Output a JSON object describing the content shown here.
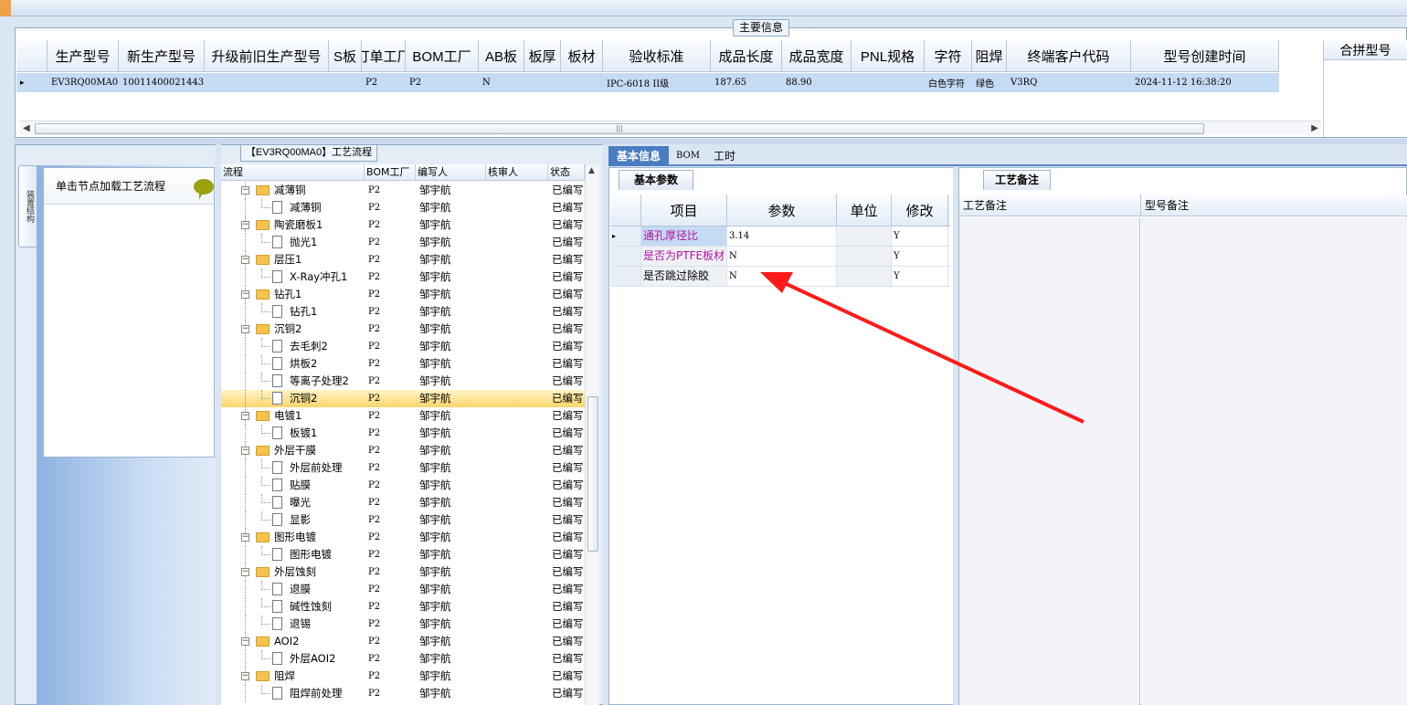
{
  "main_info": {
    "group_title": "主要信息",
    "columns": [
      "生产型号",
      "新生产型号",
      "升级前旧生产型号",
      "S板",
      "订单工厂",
      "BOM工厂",
      "AB板",
      "板厚",
      "板材",
      "验收标准",
      "成品长度",
      "成品宽度",
      "PNL规格",
      "字符",
      "阻焊",
      "终端客户代码",
      "型号创建时间"
    ],
    "row": [
      "EV3RQ00MA0",
      "10011400021443",
      "",
      "",
      "P2",
      "P2",
      "N",
      "",
      "",
      "IPC-6018 II级",
      "187.65",
      "88.90",
      "",
      "白色字符",
      "绿色",
      "V3RQ",
      "2024-11-12 16:38:20"
    ],
    "merge_header": "合拼型号"
  },
  "left": {
    "side_tab": "装置结构",
    "node_load_button": "单击节点加载工艺流程",
    "flow_title": "【EV3RQ00MA0】工艺流程",
    "tree_columns": [
      "流程",
      "BOM工厂",
      "编写人",
      "核审人",
      "状态"
    ],
    "tree_rows": [
      {
        "level": 0,
        "label": "减薄铜",
        "bom": "P2",
        "writer": "邹宇航",
        "reviewer": "",
        "status": "已编写"
      },
      {
        "level": 1,
        "label": "减薄铜",
        "bom": "P2",
        "writer": "邹宇航",
        "reviewer": "",
        "status": "已编写"
      },
      {
        "level": 0,
        "label": "陶瓷磨板1",
        "bom": "P2",
        "writer": "邹宇航",
        "reviewer": "",
        "status": "已编写"
      },
      {
        "level": 1,
        "label": "抛光1",
        "bom": "P2",
        "writer": "邹宇航",
        "reviewer": "",
        "status": "已编写"
      },
      {
        "level": 0,
        "label": "层压1",
        "bom": "P2",
        "writer": "邹宇航",
        "reviewer": "",
        "status": "已编写"
      },
      {
        "level": 1,
        "label": "X-Ray冲孔1",
        "bom": "P2",
        "writer": "邹宇航",
        "reviewer": "",
        "status": "已编写"
      },
      {
        "level": 0,
        "label": "钻孔1",
        "bom": "P2",
        "writer": "邹宇航",
        "reviewer": "",
        "status": "已编写"
      },
      {
        "level": 1,
        "label": "钻孔1",
        "bom": "P2",
        "writer": "邹宇航",
        "reviewer": "",
        "status": "已编写"
      },
      {
        "level": 0,
        "label": "沉铜2",
        "bom": "P2",
        "writer": "邹宇航",
        "reviewer": "",
        "status": "已编写"
      },
      {
        "level": 1,
        "label": "去毛刺2",
        "bom": "P2",
        "writer": "邹宇航",
        "reviewer": "",
        "status": "已编写"
      },
      {
        "level": 1,
        "label": "烘板2",
        "bom": "P2",
        "writer": "邹宇航",
        "reviewer": "",
        "status": "已编写"
      },
      {
        "level": 1,
        "label": "等离子处理2",
        "bom": "P2",
        "writer": "邹宇航",
        "reviewer": "",
        "status": "已编写"
      },
      {
        "level": 1,
        "label": "沉铜2",
        "bom": "P2",
        "writer": "邹宇航",
        "reviewer": "",
        "status": "已编写",
        "selected": true
      },
      {
        "level": 0,
        "label": "电镀1",
        "bom": "P2",
        "writer": "邹宇航",
        "reviewer": "",
        "status": "已编写"
      },
      {
        "level": 1,
        "label": "板镀1",
        "bom": "P2",
        "writer": "邹宇航",
        "reviewer": "",
        "status": "已编写"
      },
      {
        "level": 0,
        "label": "外层干膜",
        "bom": "P2",
        "writer": "邹宇航",
        "reviewer": "",
        "status": "已编写"
      },
      {
        "level": 1,
        "label": "外层前处理",
        "bom": "P2",
        "writer": "邹宇航",
        "reviewer": "",
        "status": "已编写"
      },
      {
        "level": 1,
        "label": "贴膜",
        "bom": "P2",
        "writer": "邹宇航",
        "reviewer": "",
        "status": "已编写"
      },
      {
        "level": 1,
        "label": "曝光",
        "bom": "P2",
        "writer": "邹宇航",
        "reviewer": "",
        "status": "已编写"
      },
      {
        "level": 1,
        "label": "显影",
        "bom": "P2",
        "writer": "邹宇航",
        "reviewer": "",
        "status": "已编写"
      },
      {
        "level": 0,
        "label": "图形电镀",
        "bom": "P2",
        "writer": "邹宇航",
        "reviewer": "",
        "status": "已编写"
      },
      {
        "level": 1,
        "label": "图形电镀",
        "bom": "P2",
        "writer": "邹宇航",
        "reviewer": "",
        "status": "已编写"
      },
      {
        "level": 0,
        "label": "外层蚀刻",
        "bom": "P2",
        "writer": "邹宇航",
        "reviewer": "",
        "status": "已编写"
      },
      {
        "level": 1,
        "label": "退膜",
        "bom": "P2",
        "writer": "邹宇航",
        "reviewer": "",
        "status": "已编写"
      },
      {
        "level": 1,
        "label": "碱性蚀刻",
        "bom": "P2",
        "writer": "邹宇航",
        "reviewer": "",
        "status": "已编写"
      },
      {
        "level": 1,
        "label": "退锡",
        "bom": "P2",
        "writer": "邹宇航",
        "reviewer": "",
        "status": "已编写"
      },
      {
        "level": 0,
        "label": "AOI2",
        "bom": "P2",
        "writer": "邹宇航",
        "reviewer": "",
        "status": "已编写"
      },
      {
        "level": 1,
        "label": "外层AOI2",
        "bom": "P2",
        "writer": "邹宇航",
        "reviewer": "",
        "status": "已编写"
      },
      {
        "level": 0,
        "label": "阻焊",
        "bom": "P2",
        "writer": "邹宇航",
        "reviewer": "",
        "status": "已编写"
      },
      {
        "level": 1,
        "label": "阻焊前处理",
        "bom": "P2",
        "writer": "邹宇航",
        "reviewer": "",
        "status": "已编写"
      }
    ]
  },
  "right": {
    "tabs": [
      "基本信息",
      "BOM",
      "工时"
    ],
    "basic_section": "基本参数",
    "param_columns": [
      "项目",
      "参数",
      "单位",
      "修改"
    ],
    "params": [
      {
        "item": "通孔厚径比",
        "value": "3.14",
        "unit": "",
        "edit": "Y",
        "color": "#b4139a"
      },
      {
        "item": "是否为PTFE板材",
        "value": "N",
        "unit": "",
        "edit": "Y",
        "color": "#b4139a"
      },
      {
        "item": "是否跳过除胶",
        "value": "N",
        "unit": "",
        "edit": "Y",
        "color": "#000000"
      }
    ],
    "note_section": "工艺备注",
    "note_columns": [
      "工艺备注",
      "型号备注"
    ]
  },
  "colors": {
    "annotation_arrow": "#ff1a1a",
    "selection": "#fbd56c",
    "tab_active": "#4a7dc0"
  }
}
